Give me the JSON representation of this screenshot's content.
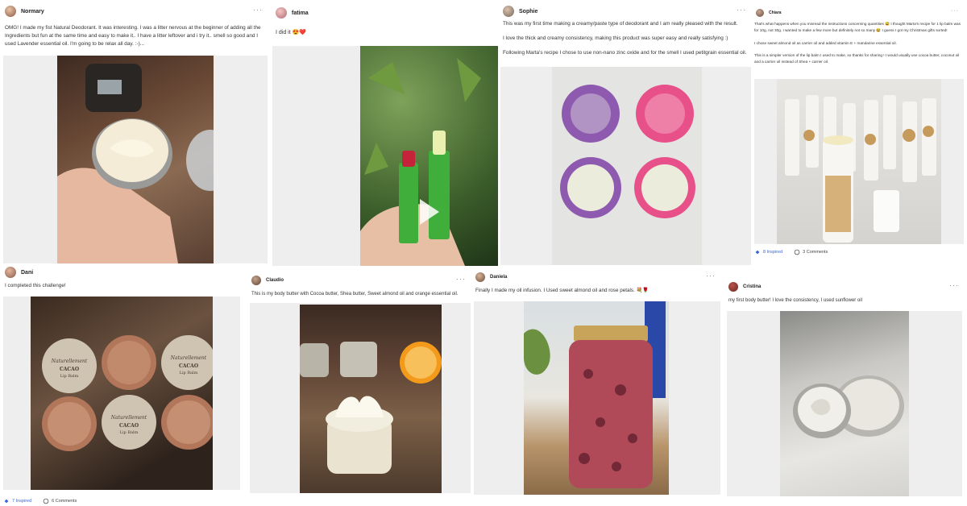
{
  "posts": [
    {
      "user": "Normary",
      "more": "···",
      "text": [
        "OMG! I made my fist Natural Deodorant. It was interesting. I was a litter nervous at the beginner of adding all the Ingredients but fun at the same time and easy to make it.. I have a litter leftover and i try it.. smell so good and I used Lavender essential oil. I'm going to be relax all day. :-)..."
      ]
    },
    {
      "user": "fatima",
      "more": "",
      "text": [
        "I did it 😍❤️"
      ]
    },
    {
      "user": "Sophie",
      "more": "···",
      "text": [
        "This was my first time making a creamy/paste type of deodorant and I am really pleased with the result.",
        "I love the thick and creamy consistency, making this product was super easy and really satisfying :)",
        "Following Marta's recipe I chose to use non-nano zinc oxide and for the smell I used petitgrain essential oil."
      ]
    },
    {
      "user": "Chiara",
      "more": "···",
      "text": [
        "That's what happens when you misread the instructions concerning quantities 😅 I thought Marta's recipe for 1 lip balm was for 10g, not 30g. I wanted to make a few more but definitely not so many 😂 I guess I got my Christmas gifts sorted!",
        "I chose sweet almond oil as carrier oil and added vitamin E + mandarine essential oil.",
        "This is a simpler version of the lip balm I used to make, so thanks for sharing ! I would usually use cocoa butter, coconut oil and a carrier oil instead of Shea + carrier oil."
      ],
      "inspired": "8 Inspired",
      "comments": "3 Comments"
    },
    {
      "user": "Dani",
      "more": "",
      "text": [
        "I completed this challenge!"
      ],
      "inspired": "7 Inspired",
      "comments": "6 Comments",
      "jar_label": "Naturellement",
      "jar_sub": "CACAO",
      "jar_type": "Lip Balm"
    },
    {
      "user": "Claudio",
      "more": "···",
      "text": [
        "This is my body butter with Cocoa butter, Shea butter, Sweet almond oil and orange essential oil."
      ]
    },
    {
      "user": "Daniela",
      "more": "···",
      "text": [
        "Finally I made my oil infusion. I Used sweet almond oil and rose petals. 💐🌹"
      ]
    },
    {
      "user": "Cristina",
      "more": "···",
      "text": [
        "my first body butter! I love the consistency, I used sunflower oil"
      ]
    }
  ],
  "colors": {
    "link": "#3a66d9",
    "media_bg": "#eeeeef"
  }
}
